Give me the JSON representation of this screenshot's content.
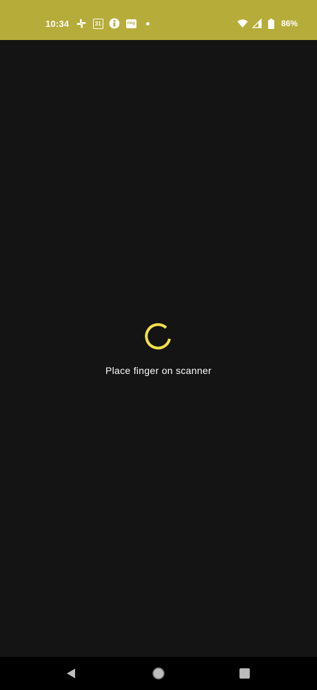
{
  "status_bar": {
    "time": "10:34",
    "calendar_day": "31",
    "ring_label": "ring",
    "battery_percent": "86%",
    "background_color": "#b5ac3a",
    "icons": [
      "slack-icon",
      "calendar-icon",
      "info-circle-icon",
      "ring-icon",
      "notification-dot-icon",
      "wifi-icon",
      "signal-icon",
      "battery-icon"
    ]
  },
  "main": {
    "prompt": "Place finger on scanner",
    "spinner_color": "#f2e14c",
    "background_color": "#141414"
  },
  "nav_bar": {
    "buttons": [
      "back-icon",
      "home-icon",
      "recents-icon"
    ]
  }
}
